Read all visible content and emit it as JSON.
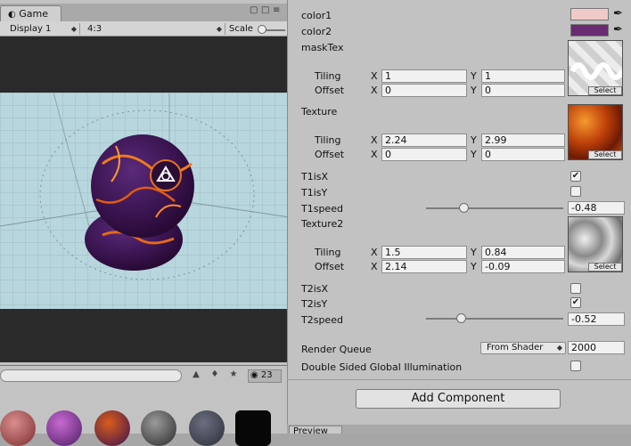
{
  "game": {
    "tab_label": "Game",
    "display_label": "Display 1",
    "aspect_label": "4:3",
    "scale_label": "Scale"
  },
  "project": {
    "count": "23"
  },
  "inspector": {
    "color1": {
      "label": "color1",
      "value": "#f0c9c9"
    },
    "color2": {
      "label": "color2",
      "value": "#6a2b72"
    },
    "maskTex": {
      "label": "maskTex",
      "tiling_label": "Tiling",
      "offset_label": "Offset",
      "tiling_x": "1",
      "tiling_y": "1",
      "offset_x": "0",
      "offset_y": "0",
      "select_label": "Select"
    },
    "texture": {
      "label": "Texture",
      "tiling_label": "Tiling",
      "offset_label": "Offset",
      "tiling_x": "2.24",
      "tiling_y": "2.99",
      "offset_x": "0",
      "offset_y": "0",
      "select_label": "Select"
    },
    "t1isx": {
      "label": "T1isX",
      "checked": true
    },
    "t1isy": {
      "label": "T1isY",
      "checked": false
    },
    "t1speed": {
      "label": "T1speed",
      "value": "-0.48",
      "slider_fraction": 0.27
    },
    "texture2": {
      "label": "Texture2",
      "tiling_label": "Tiling",
      "offset_label": "Offset",
      "tiling_x": "1.5",
      "tiling_y": "0.84",
      "offset_x": "2.14",
      "offset_y": "-0.09",
      "select_label": "Select"
    },
    "t2isx": {
      "label": "T2isX",
      "checked": false
    },
    "t2isy": {
      "label": "T2isY",
      "checked": true
    },
    "t2speed": {
      "label": "T2speed",
      "value": "-0.52",
      "slider_fraction": 0.25
    },
    "axis_x": "X",
    "axis_y": "Y",
    "render_queue": {
      "label": "Render Queue",
      "dropdown": "From Shader",
      "value": "2000"
    },
    "double_sided": {
      "label": "Double Sided Global Illumination",
      "checked": false
    },
    "add_component": "Add Component",
    "preview_tab": "Preview"
  }
}
